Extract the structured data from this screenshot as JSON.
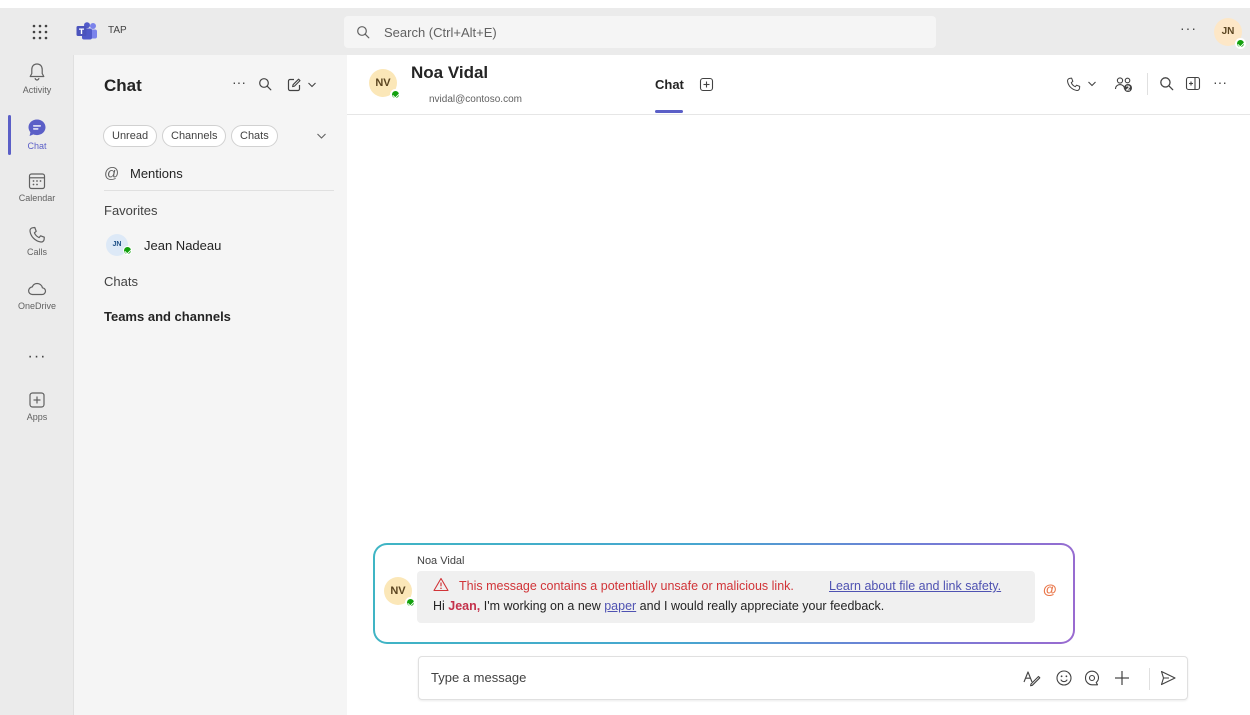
{
  "app": {
    "org_label": "TAP",
    "search_placeholder": "Search (Ctrl+Alt+E)",
    "more_label": "···",
    "user_initials": "JN"
  },
  "rail": {
    "items": [
      {
        "label": "Activity",
        "icon": "bell-icon"
      },
      {
        "label": "Chat",
        "icon": "chat-icon",
        "active": true
      },
      {
        "label": "Calendar",
        "icon": "calendar-icon"
      },
      {
        "label": "Calls",
        "icon": "phone-icon"
      },
      {
        "label": "OneDrive",
        "icon": "cloud-icon"
      },
      {
        "label": "Apps",
        "icon": "add-square-icon"
      }
    ],
    "more_label": "···"
  },
  "chat_list": {
    "title": "Chat",
    "more_label": "···",
    "filters": [
      "Unread",
      "Channels",
      "Chats"
    ],
    "mentions_symbol": "@",
    "mentions_label": "Mentions",
    "favorites_label": "Favorites",
    "favorites": [
      {
        "initials": "JN",
        "name": "Jean Nadeau"
      }
    ],
    "chats_label": "Chats",
    "teams_label": "Teams and channels"
  },
  "conversation": {
    "contact_initials": "NV",
    "contact_name": "Noa Vidal",
    "contact_email": "nvidal@contoso.com",
    "tab_label": "Chat",
    "more_label": "···",
    "message": {
      "sender": "Noa Vidal",
      "warning_text": "This message contains a potentially unsafe or malicious link.",
      "warning_link": "Learn about file and link safety.",
      "body_prefix": "Hi ",
      "mention": "Jean,",
      "body_middle": " I'm working on a new ",
      "link_text": "paper",
      "body_suffix": " and I would really appreciate your feedback.",
      "mention_marker": "@"
    },
    "composer_placeholder": "Type a message"
  },
  "colors": {
    "accent": "#5b5fc7",
    "warning": "#d13438",
    "presence": "#13a10e",
    "mention": "#c4314b"
  }
}
